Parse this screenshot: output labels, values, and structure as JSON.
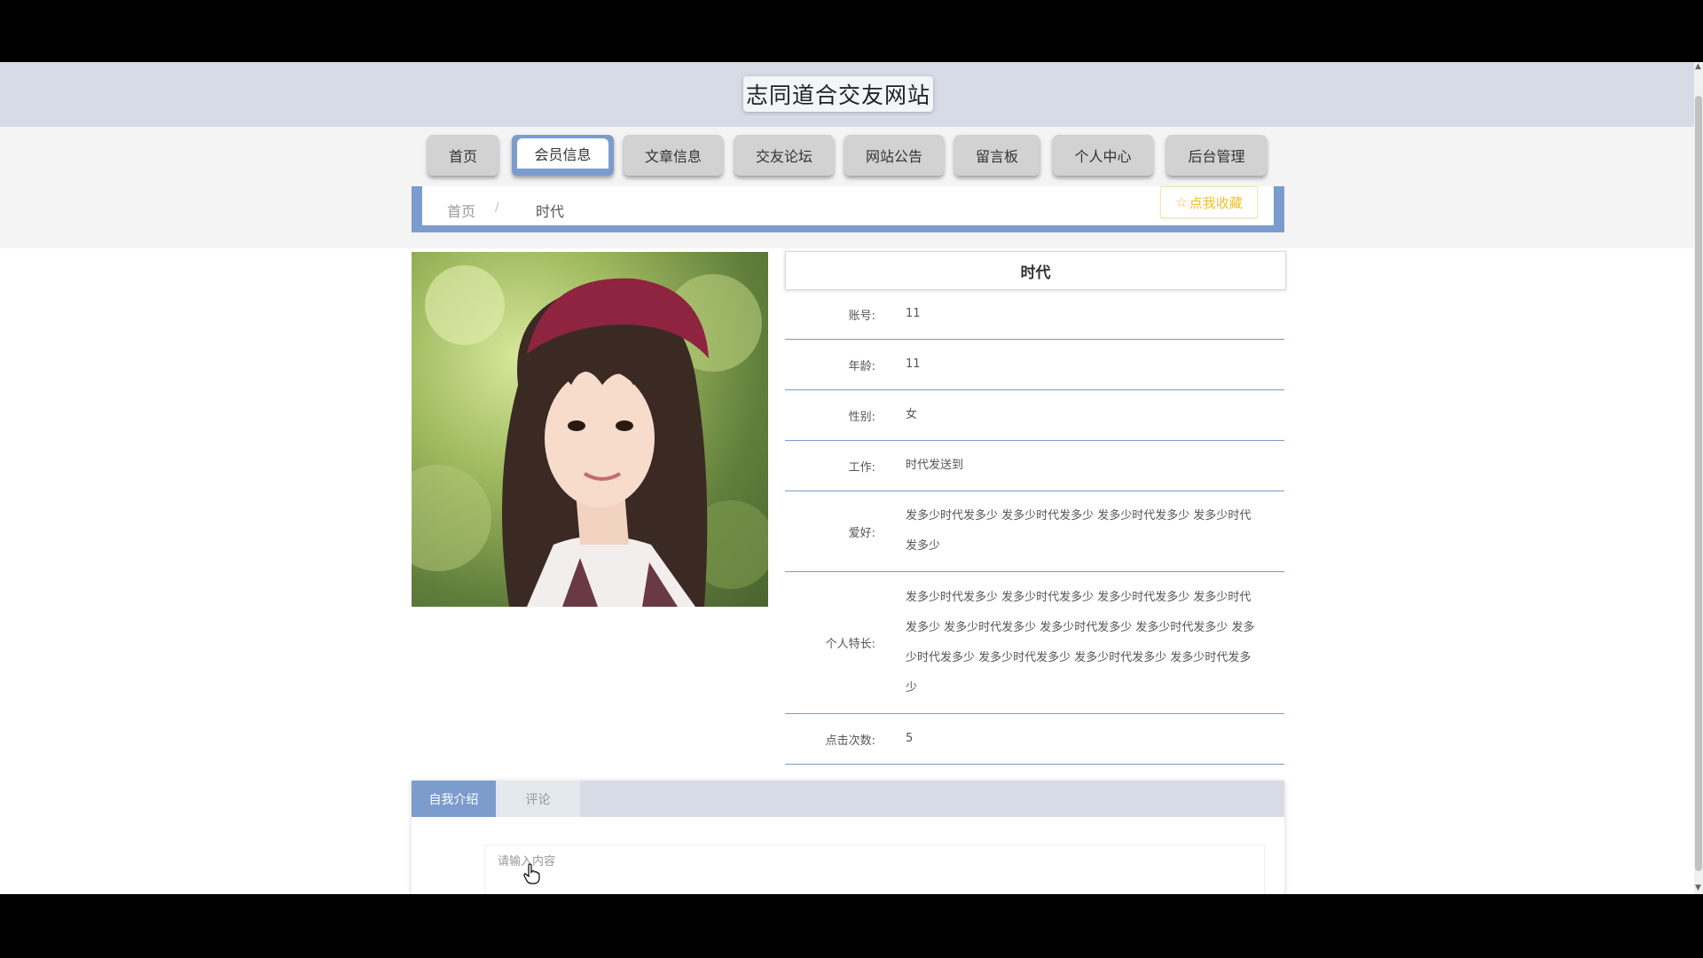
{
  "header": {
    "site_title": "志同道合交友网站"
  },
  "nav": {
    "items": [
      {
        "label": "首页"
      },
      {
        "label": "会员信息",
        "active": true
      },
      {
        "label": "文章信息"
      },
      {
        "label": "交友论坛"
      },
      {
        "label": "网站公告"
      },
      {
        "label": "留言板"
      },
      {
        "label": "个人中心"
      },
      {
        "label": "后台管理"
      }
    ]
  },
  "breadcrumb": {
    "home": "首页",
    "separator": "/",
    "current": "时代"
  },
  "favorite_button": {
    "label": "点我收藏",
    "icon": "star-outline-icon"
  },
  "profile": {
    "name": "时代",
    "fields": [
      {
        "label": "账号:",
        "value": "11"
      },
      {
        "label": "年龄:",
        "value": "11"
      },
      {
        "label": "性别:",
        "value": "女"
      },
      {
        "label": "工作:",
        "value": "时代发送到"
      },
      {
        "label": "爱好:",
        "value": "发多少时代发多少 发多少时代发多少 发多少时代发多少 发多少时代发多少"
      },
      {
        "label": "个人特长:",
        "value": "发多少时代发多少 发多少时代发多少 发多少时代发多少 发多少时代发多少 发多少时代发多少 发多少时代发多少 发多少时代发多少 发多少时代发多少 发多少时代发多少 发多少时代发多少 发多少时代发多少"
      },
      {
        "label": "点击次数:",
        "value": "5"
      }
    ]
  },
  "tabs": {
    "items": [
      {
        "label": "自我介绍",
        "active": true
      },
      {
        "label": "评论"
      }
    ]
  },
  "comment": {
    "placeholder": "请输入内容"
  },
  "colors": {
    "accent": "#7b9ccc",
    "header_bg": "#d6dbe5",
    "favorite": "#f0c02a"
  }
}
